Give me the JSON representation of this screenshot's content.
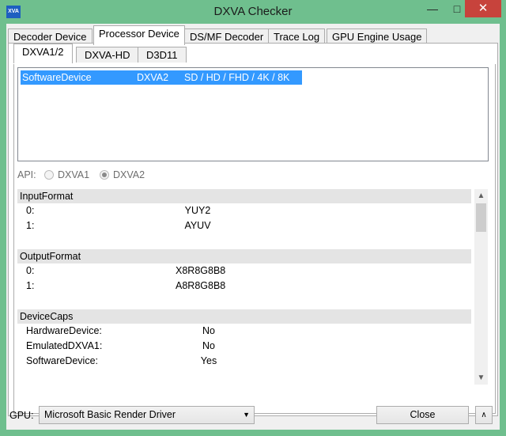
{
  "window": {
    "title": "DXVA Checker",
    "icon_text": "XVA",
    "minimize": "—",
    "maximize": "□",
    "close": "✕"
  },
  "tabs": [
    {
      "label": "Decoder Device",
      "active": false
    },
    {
      "label": "Processor Device",
      "active": true
    },
    {
      "label": "DS/MF Decoder",
      "active": false
    },
    {
      "label": "Trace Log",
      "active": false
    },
    {
      "label": "GPU Engine Usage",
      "active": false
    }
  ],
  "subtabs": [
    {
      "label": "DXVA1/2",
      "active": true
    },
    {
      "label": "DXVA-HD",
      "active": false
    },
    {
      "label": "D3D11",
      "active": false
    }
  ],
  "device_list": [
    {
      "name": "SoftwareDevice",
      "api": "DXVA2",
      "resolutions": "SD / HD / FHD / 4K / 8K",
      "selected": true
    }
  ],
  "api": {
    "label": "API:",
    "options": [
      {
        "label": "DXVA1",
        "checked": false
      },
      {
        "label": "DXVA2",
        "checked": true
      }
    ]
  },
  "caps": {
    "input_format": {
      "title": "InputFormat",
      "rows": [
        {
          "key": "0:",
          "value": "YUY2"
        },
        {
          "key": "1:",
          "value": "AYUV"
        }
      ]
    },
    "output_format": {
      "title": "OutputFormat",
      "rows": [
        {
          "key": "0:",
          "value": "X8R8G8B8"
        },
        {
          "key": "1:",
          "value": "A8R8G8B8"
        }
      ]
    },
    "device_caps": {
      "title": "DeviceCaps",
      "rows": [
        {
          "key": "HardwareDevice:",
          "value": "No"
        },
        {
          "key": "EmulatedDXVA1:",
          "value": "No"
        },
        {
          "key": "SoftwareDevice:",
          "value": "Yes"
        }
      ]
    }
  },
  "bottom": {
    "gpu_label": "GPU:",
    "gpu_selected": "Microsoft Basic Render Driver",
    "close_label": "Close",
    "expand_icon": "∧"
  },
  "colors": {
    "titlebar": "#6fbf8e",
    "selection": "#3399ff",
    "close_button": "#c7433c"
  }
}
